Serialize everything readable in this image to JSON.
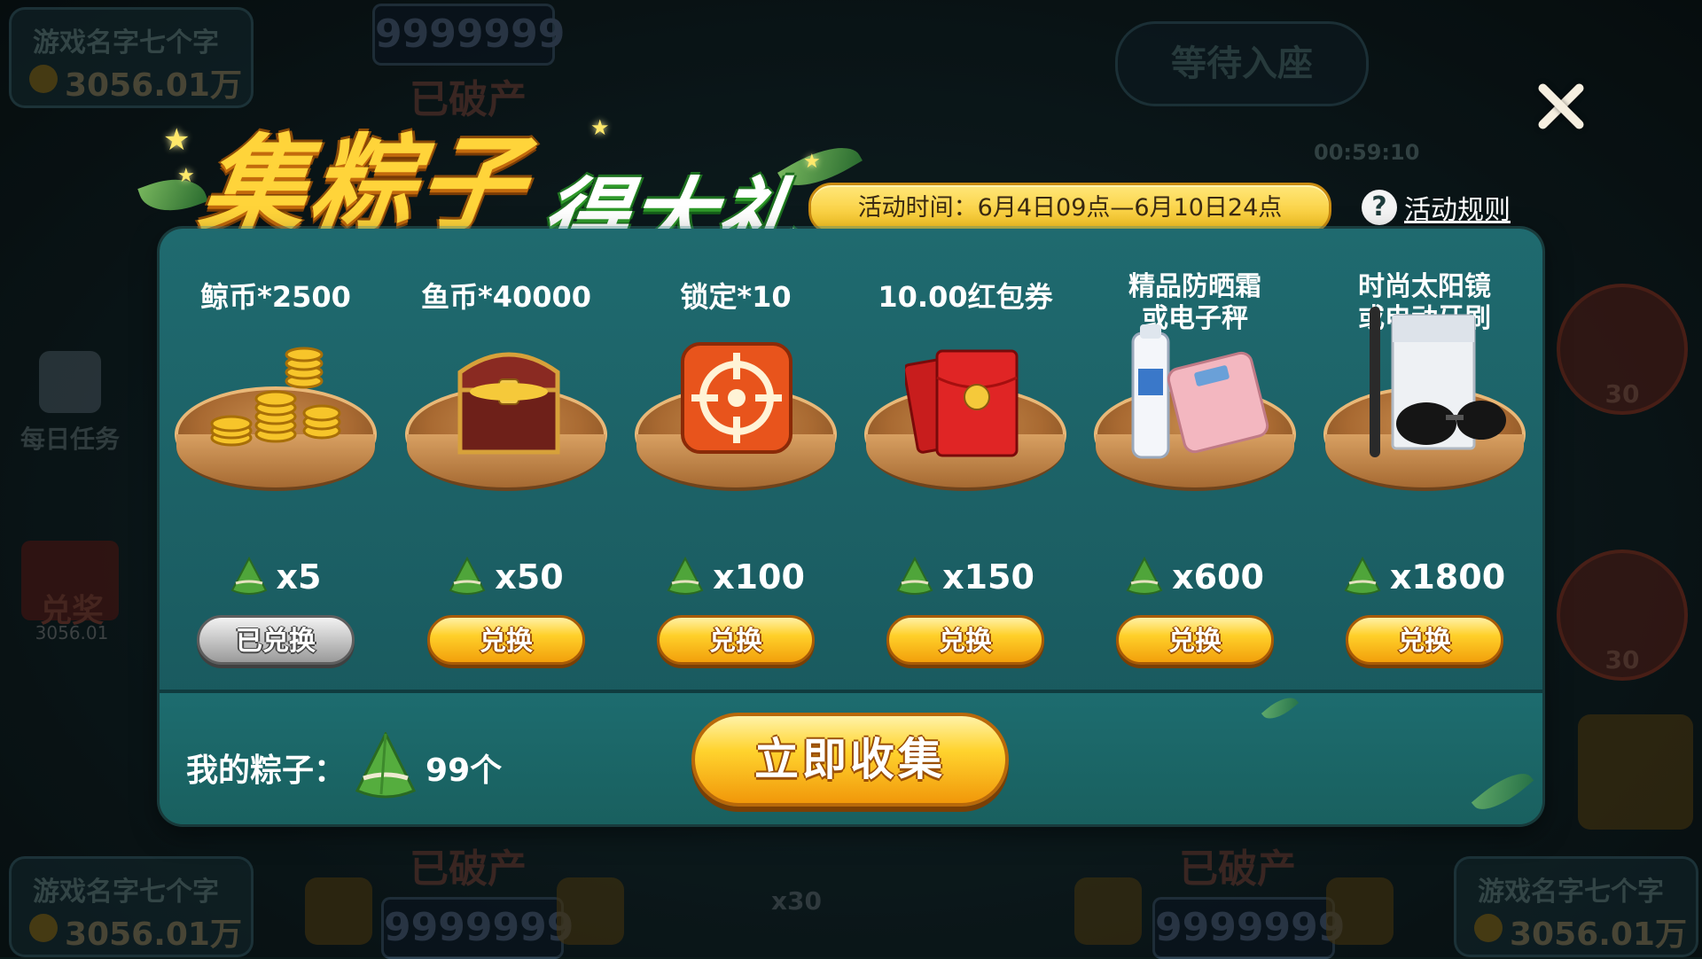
{
  "background": {
    "seat_name": "游戏名字七个字",
    "seat_coins": "3056.01万",
    "bet_value": "9999999",
    "bankrupt": "已破产",
    "waiting": "等待入座",
    "timer": "00:59:10",
    "daily_task": "每日任务",
    "exchange": "兑奖",
    "exchange_coins": "3056.01",
    "lock_count": "30",
    "multiplier": "x30"
  },
  "event": {
    "title_main": "集粽子",
    "title_sub": "得大礼",
    "time_label": "活动时间：6月4日09点—6月10日24点",
    "rules_label": "活动规则",
    "rules_icon": "?"
  },
  "rewards": [
    {
      "name": "鲸币*2500",
      "cost": "x5",
      "button": "已兑换",
      "redeemed": true,
      "icon": "gold-coins-icon"
    },
    {
      "name": "鱼币*40000",
      "cost": "x50",
      "button": "兑换",
      "redeemed": false,
      "icon": "treasure-chest-icon"
    },
    {
      "name": "锁定*10",
      "cost": "x100",
      "button": "兑换",
      "redeemed": false,
      "icon": "lock-target-icon"
    },
    {
      "name": "10.00红包券",
      "cost": "x150",
      "button": "兑换",
      "redeemed": false,
      "icon": "red-envelope-icon"
    },
    {
      "name_line1": "精品防晒霜",
      "name_line2": "或电子秤",
      "cost": "x600",
      "button": "兑换",
      "redeemed": false,
      "icon": "sunscreen-scale-icon"
    },
    {
      "name_line1": "时尚太阳镜",
      "name_line2": "或电动牙刷",
      "cost": "x1800",
      "button": "兑换",
      "redeemed": false,
      "icon": "sunglasses-toothbrush-icon"
    }
  ],
  "footer": {
    "my_label": "我的粽子：",
    "my_count": "99个",
    "collect_label": "立即收集"
  },
  "colors": {
    "panel": "#1f6a6f",
    "gold_button": "#ffd02a",
    "title_yellow": "#ffd43a",
    "title_green": "#2f9a2a"
  }
}
